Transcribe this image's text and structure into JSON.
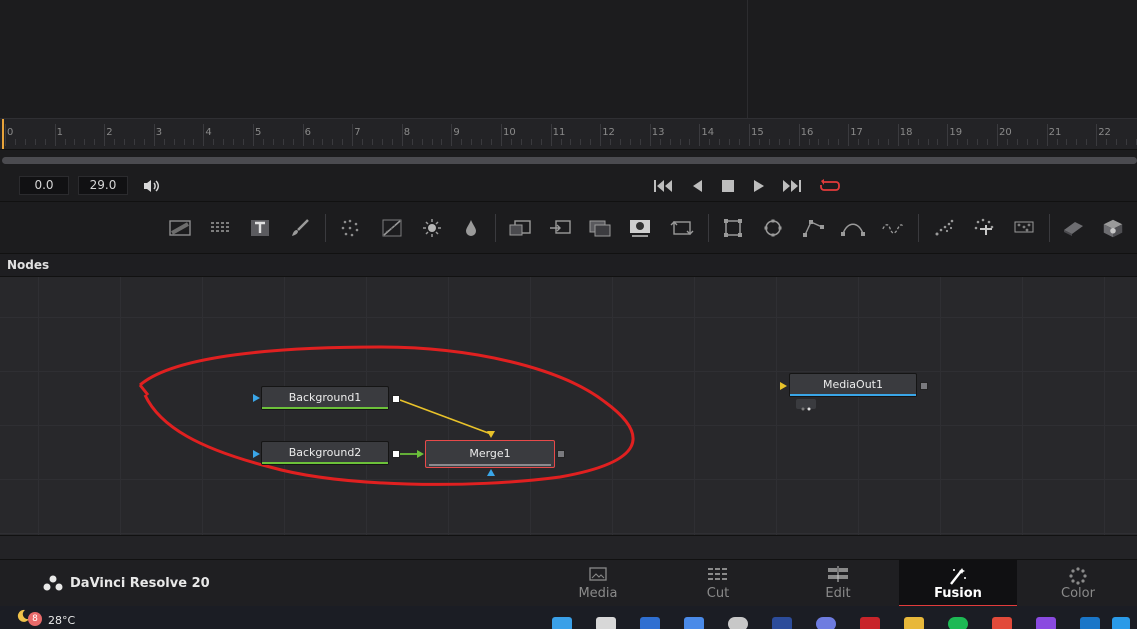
{
  "ruler": {
    "ticks": [
      "0",
      "1",
      "2",
      "3",
      "4",
      "5",
      "6",
      "7",
      "8",
      "9",
      "10",
      "11",
      "12",
      "13",
      "14",
      "15",
      "16",
      "17",
      "18",
      "19",
      "20",
      "21",
      "22"
    ]
  },
  "transport": {
    "current_time": "0.0",
    "end_time": "29.0"
  },
  "nodes_panel": {
    "title": "Nodes",
    "nodes": {
      "background1": "Background1",
      "background2": "Background2",
      "merge1": "Merge1",
      "mediaout1": "MediaOut1"
    }
  },
  "app": {
    "name": "DaVinci Resolve 20"
  },
  "pages": {
    "media": "Media",
    "cut": "Cut",
    "edit": "Edit",
    "fusion": "Fusion",
    "color": "Color"
  },
  "taskbar": {
    "weather_badge": "8",
    "temperature": "28°C"
  },
  "colors": {
    "accent_red": "#e23b3b",
    "playhead": "#e8a33a",
    "wire_yellow": "#e8c22a",
    "wire_green": "#6cc13a",
    "input_blue": "#3aa6e8",
    "annotation_red": "#e02020"
  }
}
